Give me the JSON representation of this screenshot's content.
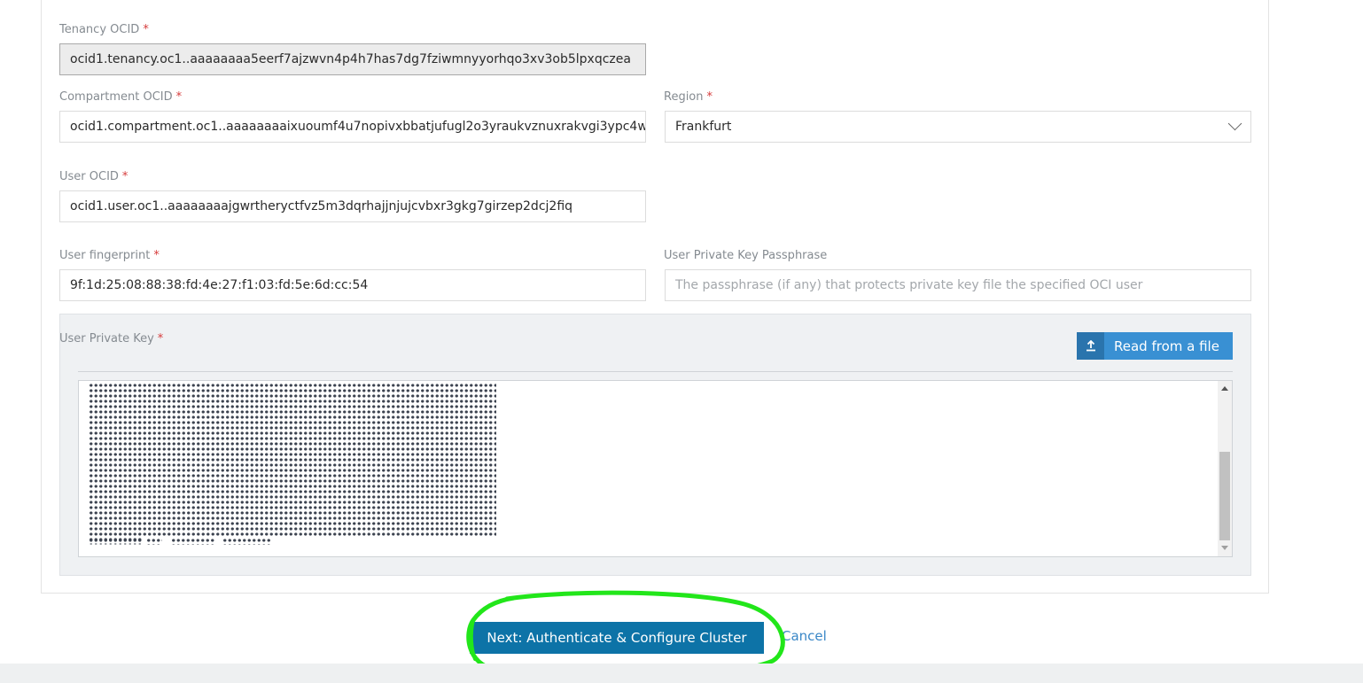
{
  "tenancy": {
    "label": "Tenancy OCID",
    "required": "*",
    "value": "ocid1.tenancy.oc1..aaaaaaaa5eerf7ajzwvn4p4h7has7dg7fziwmnyyorhqo3xv3ob5lpxqczea"
  },
  "compartment": {
    "label": "Compartment OCID",
    "required": "*",
    "value": "ocid1.compartment.oc1..aaaaaaaaixuoumf4u7nopivxbbatjufugl2o3yraukvznuxrakvgi3ypc4w"
  },
  "region": {
    "label": "Region",
    "required": "*",
    "value": "Frankfurt"
  },
  "user": {
    "label": "User OCID",
    "required": "*",
    "value": "ocid1.user.oc1..aaaaaaaajgwrtheryctfvz5m3dqrhajjnjujcvbxr3gkg7girzep2dcj2fiq"
  },
  "fingerprint": {
    "label": "User fingerprint",
    "required": "*",
    "value": "9f:1d:25:08:88:38:fd:4e:27:f1:03:fd:5e:6d:cc:54"
  },
  "passphrase": {
    "label": "User Private Key Passphrase",
    "placeholder": "The passphrase (if any) that protects private key file the specified OCI user"
  },
  "private_key": {
    "label": "User Private Key",
    "required": "*",
    "read_button": "Read from a file",
    "masked": true
  },
  "actions": {
    "next_label": "Next: Authenticate & Configure Cluster",
    "cancel_label": "Cancel"
  },
  "colors": {
    "primary": "#0d73a7",
    "accent": "#3990d3",
    "highlight": "#22e61a",
    "required": "#d63b3b"
  }
}
